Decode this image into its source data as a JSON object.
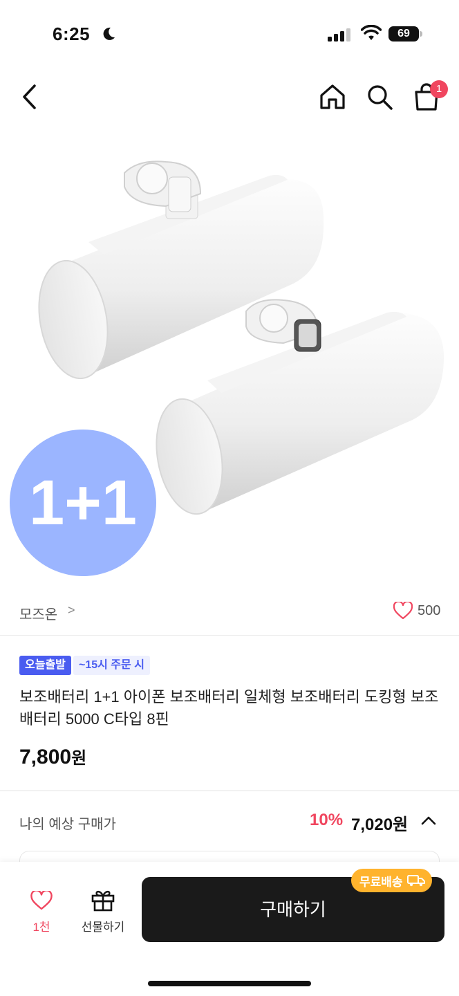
{
  "status_bar": {
    "time": "6:25",
    "battery": "69"
  },
  "header": {
    "cart_count": "1"
  },
  "product_image": {
    "promo_text": "1+1"
  },
  "brand": {
    "name": "모즈온",
    "chevron": ">",
    "like_count": "500"
  },
  "badges": {
    "today_ship": "오늘출발",
    "cutoff": "~15시 주문 시"
  },
  "product": {
    "title": "보조배터리 1+1 아이폰 보조배터리 일체형 보조배터리 도킹형 보조배터리 5000 C타입 8핀",
    "price": "7,800",
    "price_unit": "원"
  },
  "expected": {
    "label": "나의 예상 구매가",
    "discount": "10%",
    "price": "7,020원"
  },
  "bottom_bar": {
    "wish_label": "1천",
    "gift_label": "선물하기",
    "buy_label": "구매하기",
    "free_shipping": "무료배송"
  },
  "colors": {
    "accent_red": "#f0465f",
    "blue_badge": "#4a5cf0",
    "promo_circle": "#9bb5ff",
    "shipping_orange": "#ffb32d"
  }
}
